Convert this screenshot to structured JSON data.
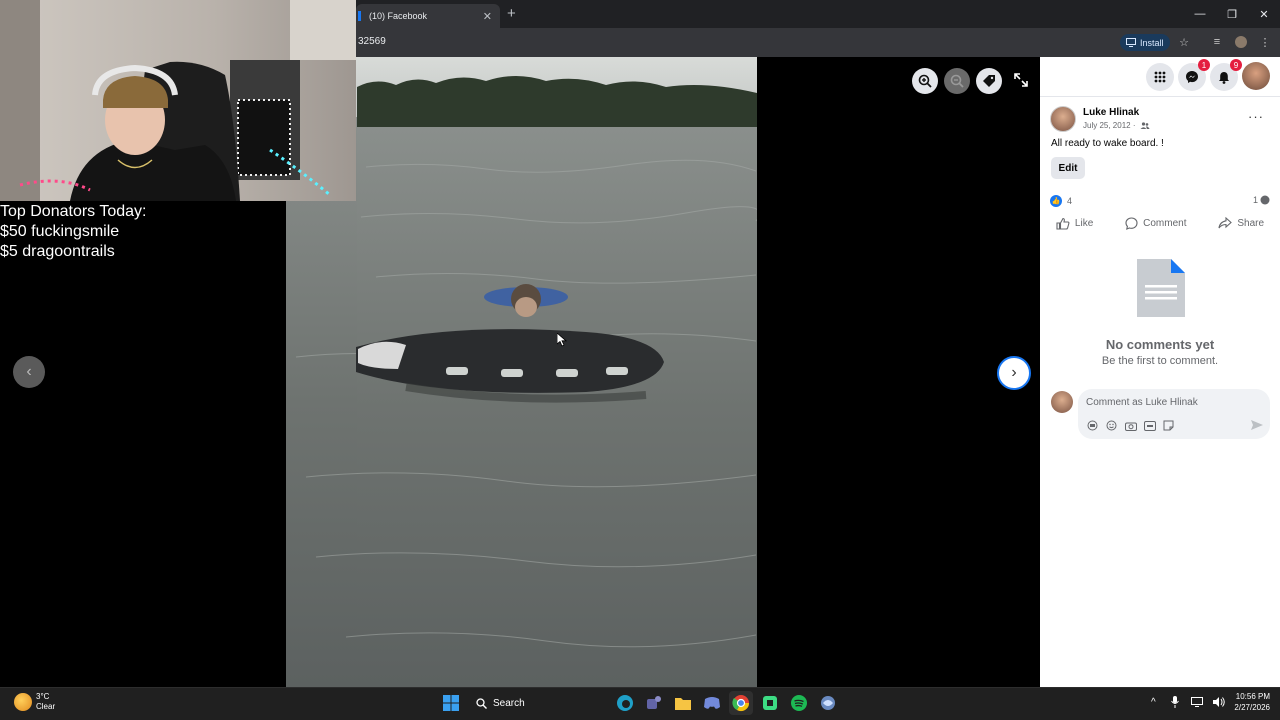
{
  "browser": {
    "tab_title": "(10) Facebook",
    "tab_close": "✕",
    "new_tab": "+",
    "url": "32569",
    "install_label": "Install",
    "win_minimize": "—",
    "win_restore": "❐",
    "win_close": "✕"
  },
  "overlay": {
    "donators_title": "Top Donators Today:",
    "donator_1": "$50 fuckingsmile",
    "donator_2": "$5 dragoontrails"
  },
  "viewer": {
    "prev_arrow": "‹",
    "next_arrow": "›"
  },
  "post": {
    "author": "Luke Hlinak",
    "date": "July 25, 2012 ·",
    "more": "···",
    "caption": "All ready to wake board. !",
    "edit_label": "Edit",
    "like_count": "4",
    "comment_count": "1",
    "actions": {
      "like": "Like",
      "comment": "Comment",
      "share": "Share"
    },
    "no_comments_title": "No comments yet",
    "no_comments_sub": "Be the first to comment.",
    "comment_placeholder": "Comment as Luke Hlinak"
  },
  "notifications": {
    "messenger_badge": "1",
    "bell_badge": "9"
  },
  "taskbar": {
    "temp": "3°C",
    "weather": "Clear",
    "search_label": "Search",
    "time": "10:56 PM",
    "date": "2/27/2026"
  },
  "colors": {
    "facebook_blue": "#1877f2",
    "badge_red": "#e41e3f",
    "taskbar_bg": "#202020"
  }
}
